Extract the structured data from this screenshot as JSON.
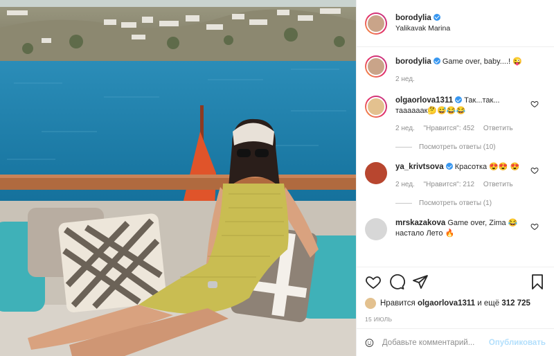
{
  "post": {
    "author": "borodylia",
    "location": "Yalikavak Marina",
    "caption": "Game over, baby....! 😜",
    "caption_time": "2 нед."
  },
  "comments": [
    {
      "user": "olgaorlova1311",
      "text": "Так...так... таааааак🤔😅😂😂",
      "time": "2 нед.",
      "likes": "\"Нравится\": 452",
      "reply_label": "Ответить",
      "view_replies": "Посмотреть ответы (10)"
    },
    {
      "user": "ya_krivtsova",
      "text": "Красотка 😍😍 😍",
      "time": "2 нед.",
      "likes": "\"Нравится\": 212",
      "reply_label": "Ответить",
      "view_replies": "Посмотреть ответы (1)"
    },
    {
      "user": "mrskazakova",
      "text": "Game over, Zima 😂 настало Лето 🔥"
    }
  ],
  "likes": {
    "prefix": "Нравится",
    "user": "olgaorlova1311",
    "middle": "и ещё",
    "count": "312 725"
  },
  "date": "15 ИЮЛЬ",
  "add_comment": {
    "placeholder": "Добавьте комментарий...",
    "post_label": "Опубликовать"
  },
  "colors": {
    "verified": "#3897f0",
    "post_disabled": "#b2dffc",
    "sea": "#1f7fa8"
  },
  "icons": [
    "heart-icon",
    "comment-icon",
    "share-icon",
    "bookmark-icon",
    "emoji-icon",
    "verified-badge-icon"
  ]
}
